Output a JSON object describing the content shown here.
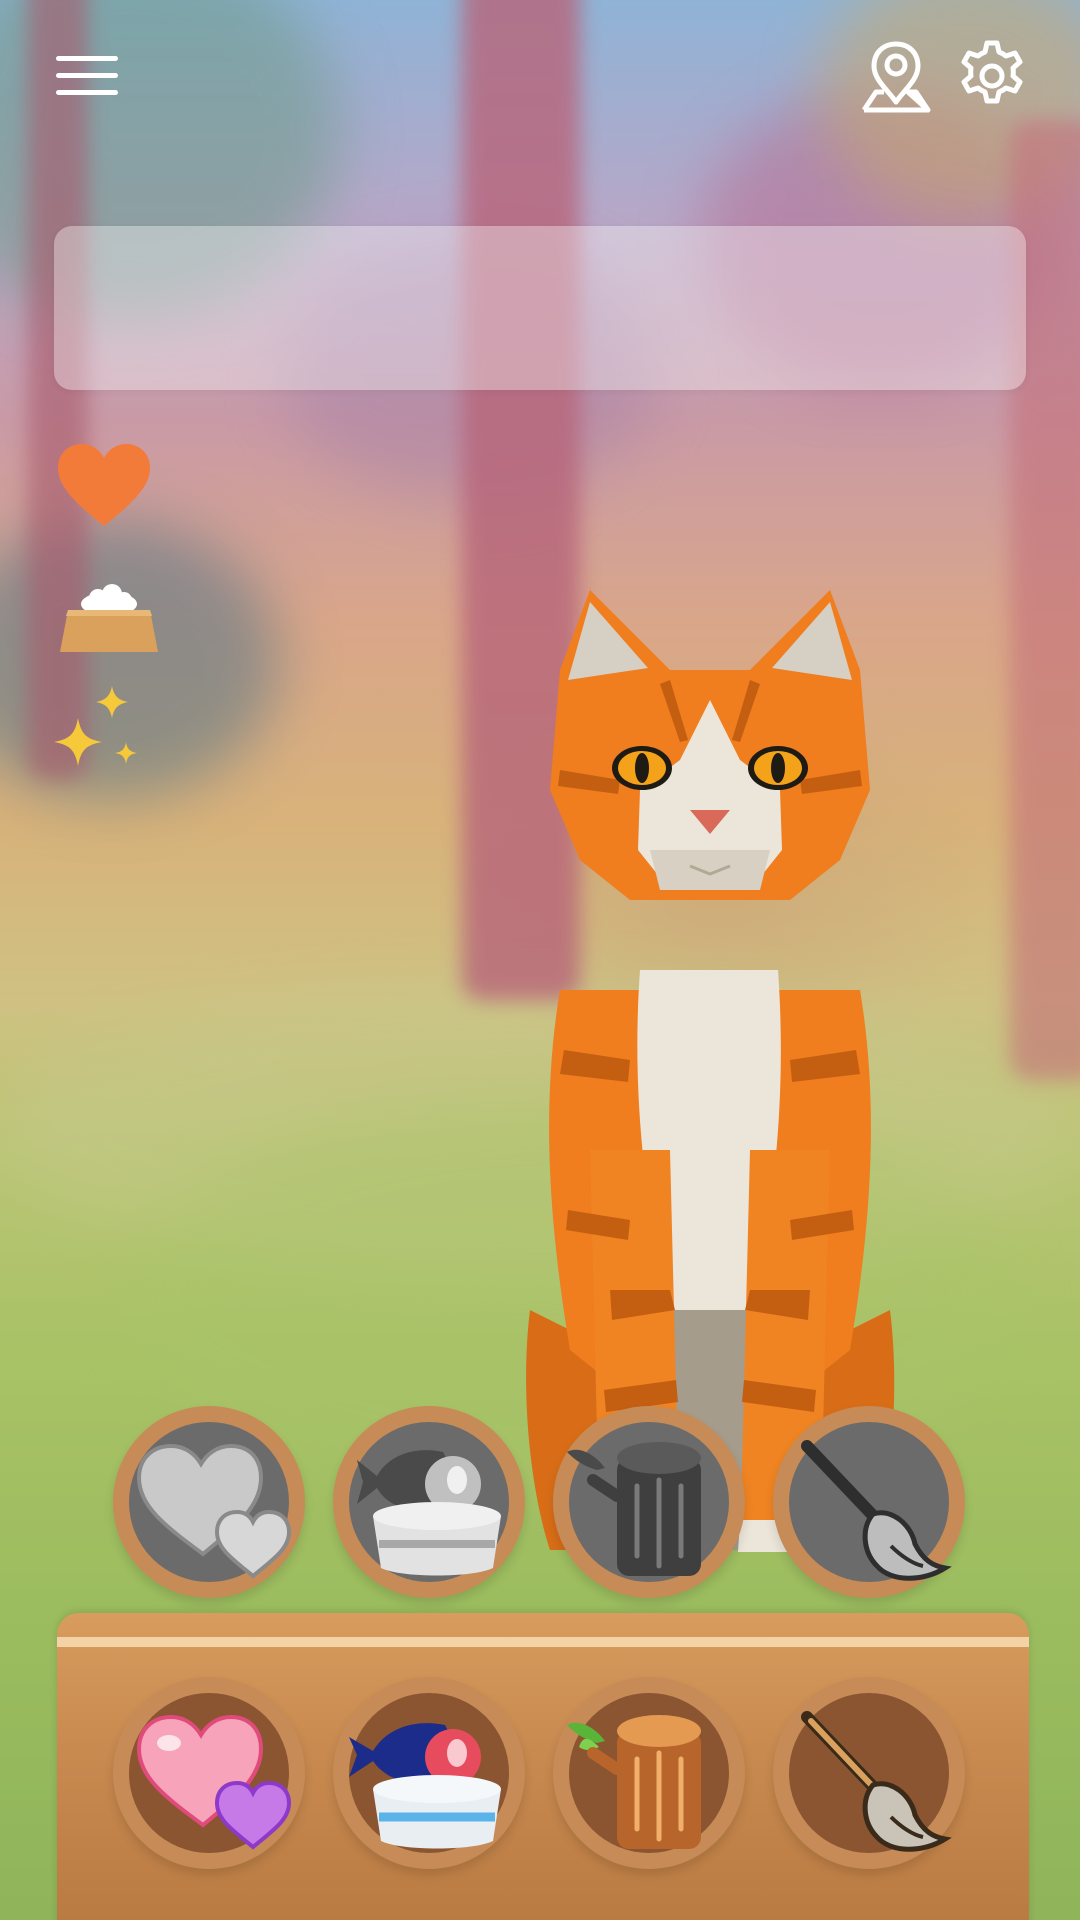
{
  "top_bar": {
    "menu_icon": "hamburger-menu-icon",
    "location_icon": "location-pin-icon",
    "settings_icon": "gear-icon",
    "icon_color": "#ffffff"
  },
  "message_panel": {
    "text": ""
  },
  "status": {
    "affection": {
      "icon": "heart-icon",
      "color": "#f37b3a"
    },
    "hunger": {
      "icon": "food-bowl-icon",
      "color": "#d9a15c"
    },
    "cleanliness": {
      "icon": "sparkles-icon",
      "color": "#f6c93a"
    }
  },
  "actions": {
    "inactive": [
      {
        "id": "love",
        "icon": "hearts-icon",
        "state": "disabled"
      },
      {
        "id": "feed",
        "icon": "fish-bowl-icon",
        "state": "disabled"
      },
      {
        "id": "scratch",
        "icon": "scratching-log-icon",
        "state": "disabled"
      },
      {
        "id": "groom",
        "icon": "broom-icon",
        "state": "disabled"
      }
    ],
    "active": [
      {
        "id": "love",
        "icon": "hearts-icon",
        "state": "enabled"
      },
      {
        "id": "feed",
        "icon": "fish-bowl-icon",
        "state": "enabled"
      },
      {
        "id": "scratch",
        "icon": "scratching-log-icon",
        "state": "enabled"
      },
      {
        "id": "groom",
        "icon": "broom-icon",
        "state": "enabled"
      }
    ]
  },
  "colors": {
    "button_ring": "#c68b56",
    "tray": "#c98b50",
    "tray_stripe": "#f3d3a6",
    "cat_orange": "#f07d1e",
    "cat_white": "#ece6da"
  }
}
